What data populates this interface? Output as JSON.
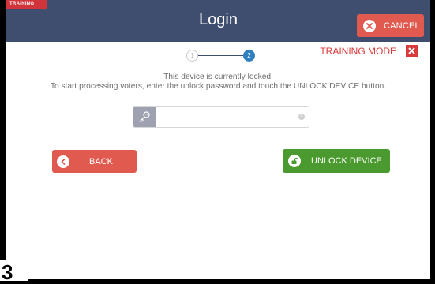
{
  "header": {
    "training_tag": "TRAINING",
    "title": "Login",
    "cancel_label": "CANCEL"
  },
  "steps": {
    "step1": "1",
    "step2": "2",
    "current": 2
  },
  "training_mode": {
    "label": "TRAINING MODE"
  },
  "message": {
    "line1": "This device is currently locked.",
    "line2": "To start processing voters, enter the unlock password and touch the UNLOCK DEVICE button."
  },
  "password": {
    "value": "",
    "placeholder": ""
  },
  "buttons": {
    "back_label": "BACK",
    "unlock_label": "UNLOCK DEVICE"
  },
  "photo_number": "3",
  "icons": {
    "cancel": "close-circle-icon",
    "training_close": "close-icon",
    "password": "key-icon",
    "clear": "clear-icon",
    "back": "chevron-left-circle-icon",
    "unlock": "unlock-icon"
  },
  "colors": {
    "header_bg": "#3f4d6f",
    "cancel_bg": "#e05a4f",
    "unlock_bg": "#4b9a2f",
    "step_active": "#2f7fc1",
    "training_red": "#d93a3a"
  }
}
